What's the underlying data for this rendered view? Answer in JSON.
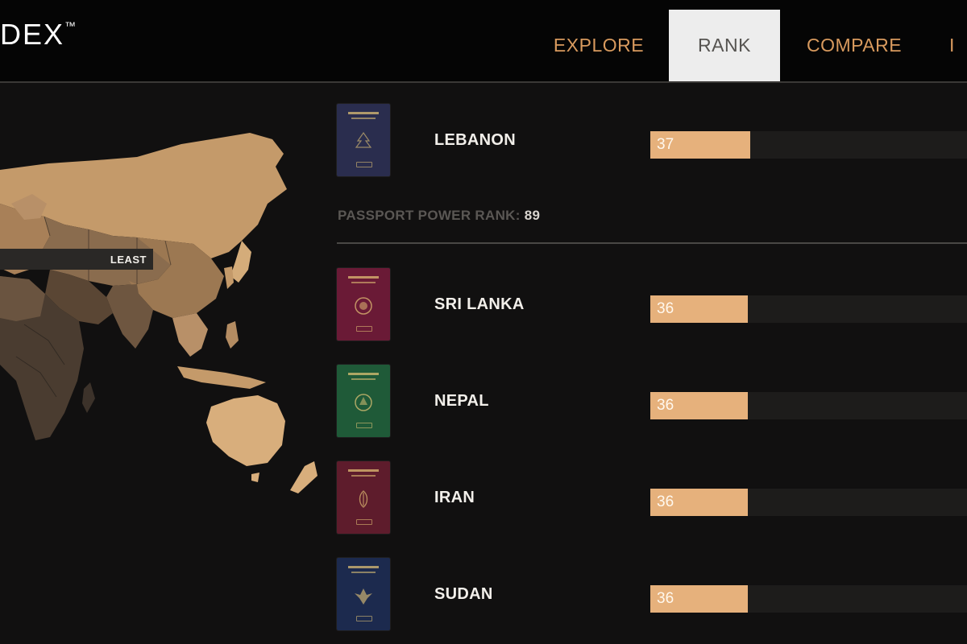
{
  "header": {
    "logo_text": "DEX",
    "logo_mark": "™",
    "nav": [
      {
        "label": "EXPLORE",
        "active": false
      },
      {
        "label": "RANK",
        "active": true
      },
      {
        "label": "COMPARE",
        "active": false
      },
      {
        "label": "I",
        "active": false
      }
    ]
  },
  "map": {
    "legend_label": "LEAST",
    "colors": {
      "most": "#c8a070",
      "least": "#2a2622",
      "mid": "#7a6048"
    }
  },
  "power_rank": {
    "label": "PASSPORT POWER RANK:",
    "value": "89"
  },
  "countries": [
    {
      "name": "LEBANON",
      "score": "37",
      "cover_color": "#2a2d4e",
      "icon": "passport-cover"
    },
    {
      "name": "SRI LANKA",
      "score": "36",
      "cover_color": "#6a1a36",
      "icon": "passport-cover"
    },
    {
      "name": "NEPAL",
      "score": "36",
      "cover_color": "#1f5a38",
      "icon": "passport-cover"
    },
    {
      "name": "IRAN",
      "score": "36",
      "cover_color": "#5e1c2c",
      "icon": "passport-cover"
    },
    {
      "name": "SUDAN",
      "score": "36",
      "cover_color": "#1c2a4e",
      "icon": "passport-cover"
    }
  ],
  "colors": {
    "accent": "#d89a5e",
    "bar": "#e6b17c",
    "track": "#1d1c1b",
    "background": "#111010"
  }
}
